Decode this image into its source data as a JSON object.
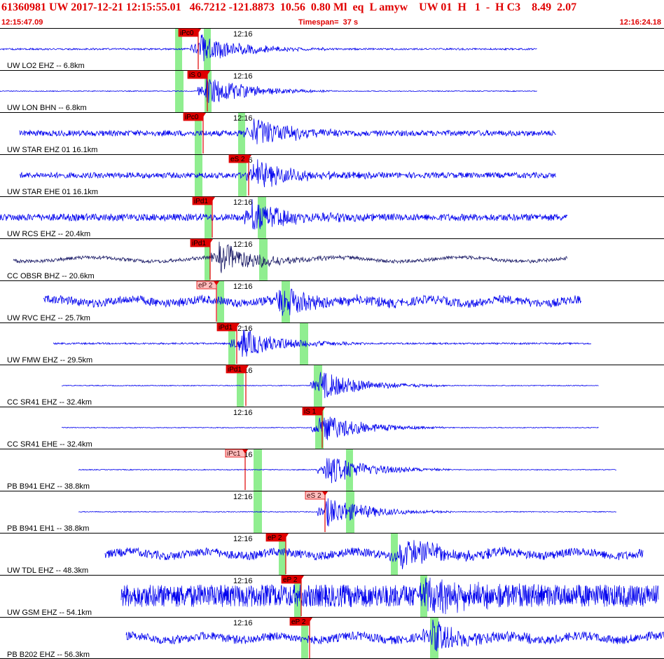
{
  "header": {
    "title": "61360981 UW 2017-12-21 12:15:55.01   46.7212 -121.8873  10.56  0.80 Ml  eq  L amyw    UW 01  H   1  -  H C3    8.49  2.07",
    "start_time": "12:15:47.09",
    "timespan": "Timespan=  37 s",
    "end_time": "12:16:24.18"
  },
  "colors": {
    "trace": "#0000ee",
    "trace_dark": "#1a1a66",
    "pick": "#e00000",
    "pick_light": "#ffc0c0",
    "window": "#90ee90",
    "text": "#000000"
  },
  "tick_label": "12:16",
  "channels": [
    {
      "label": "UW LO2 EHZ -- 6.8km",
      "pick": "iPc0",
      "pick_style": "dark",
      "traceStart": 0,
      "traceEnd": 0.809,
      "amp": "low",
      "event": 0.3
    },
    {
      "label": "UW LON BHN -- 6.8km",
      "pick": "iS 0",
      "pick_style": "dark",
      "traceStart": 0,
      "traceEnd": 0.809,
      "amp": "vlow",
      "event": 0.31
    },
    {
      "label": "UW STAR EHZ 01 16.1km",
      "pick": "iPc0",
      "pick_style": "dark",
      "traceStart": 0.03,
      "traceEnd": 0.838,
      "amp": "med",
      "event": 0.38
    },
    {
      "label": "UW STAR EHE 01 16.1km",
      "pick": "eS 2",
      "pick_style": "dark",
      "traceStart": 0.03,
      "traceEnd": 0.838,
      "amp": "med",
      "event": 0.38
    },
    {
      "label": "UW RCS EHZ -- 20.4km",
      "pick": "iPd1",
      "pick_style": "dark",
      "traceStart": 0.0,
      "traceEnd": 0.854,
      "amp": "high",
      "event": 0.38
    },
    {
      "label": "CC OBSR BHZ -- 20.6km",
      "pick": "iPd1",
      "pick_style": "dark",
      "traceStart": 0.02,
      "traceEnd": 0.854,
      "amp": "wave",
      "event": 0.33
    },
    {
      "label": "UW RVC EHZ -- 25.7km",
      "pick": "eP 2",
      "pick_style": "light",
      "traceStart": 0.065,
      "traceEnd": 0.876,
      "amp": "noisy",
      "event": 0.42
    },
    {
      "label": "UW FMW EHZ -- 29.5km",
      "pick": "iPd1",
      "pick_style": "dark",
      "traceStart": 0.08,
      "traceEnd": 0.89,
      "amp": "low",
      "event": 0.36
    },
    {
      "label": "CC SR41 EHZ -- 32.4km",
      "pick": "iPd1",
      "pick_style": "dark",
      "traceStart": 0.093,
      "traceEnd": 0.902,
      "amp": "vlow",
      "event": 0.48
    },
    {
      "label": "CC SR41 EHE -- 32.4km",
      "pick": "iS 1",
      "pick_style": "dark",
      "traceStart": 0.093,
      "traceEnd": 0.902,
      "amp": "vlow",
      "event": 0.48
    },
    {
      "label": "PB B941 EHZ -- 38.8km",
      "pick": "iPc1",
      "pick_style": "light",
      "traceStart": 0.118,
      "traceEnd": 0.928,
      "amp": "vlow",
      "event": 0.49
    },
    {
      "label": "PB B941 EH1 -- 38.8km",
      "pick": "eS 2",
      "pick_style": "light",
      "traceStart": 0.118,
      "traceEnd": 0.928,
      "amp": "vlow",
      "event": 0.49
    },
    {
      "label": "UW TDL EHZ -- 48.3km",
      "pick": "eP 2",
      "pick_style": "dark",
      "traceStart": 0.158,
      "traceEnd": 0.968,
      "amp": "noisy",
      "event": 0.6
    },
    {
      "label": "UW GSM EHZ -- 54.1km",
      "pick": "eP 2",
      "pick_style": "dark",
      "traceStart": 0.183,
      "traceEnd": 0.992,
      "amp": "block",
      "event": 0.64
    },
    {
      "label": "PB B202 EHZ -- 56.3km",
      "pick": "eP 2",
      "pick_style": "dark",
      "traceStart": 0.19,
      "traceEnd": 1.0,
      "amp": "noisy",
      "event": 0.65
    }
  ]
}
